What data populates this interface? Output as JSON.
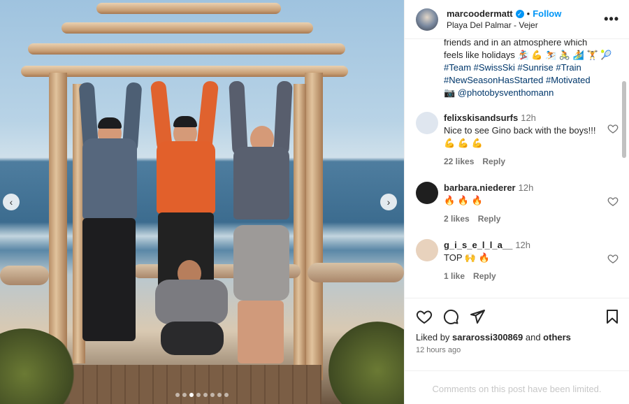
{
  "post": {
    "username": "marcoodermatt",
    "verified_mark": "✓",
    "separator": "•",
    "follow_label": "Follow",
    "location": "Playa Del Palmar - Vejer",
    "more_label": "•••"
  },
  "caption": {
    "line1": "friends and in an atmosphere which",
    "line2": "feels like holidays 🏂 💪 ⛷️ 🚴 🏄 🏋️ 🎾",
    "tags1": "#Team #SwissSki #Sunrise #Train",
    "tags2": "#NewSeasonHasStarted #Motivated",
    "credit": "📷 @photobysventhomann"
  },
  "comments": [
    {
      "user": "felixskisandsurfs",
      "time": "12h",
      "text": "Nice to see Gino back with the boys!!! 💪 💪 💪",
      "likes": "22 likes",
      "reply": "Reply",
      "avatar_color": "#dfe6ef"
    },
    {
      "user": "barbara.niederer",
      "time": "12h",
      "text": "🔥 🔥 🔥",
      "likes": "2 likes",
      "reply": "Reply",
      "avatar_color": "#1f1f1f"
    },
    {
      "user": "g_i_s_e_l_l_a__",
      "time": "12h",
      "text": "TOP 🙌 🔥",
      "likes": "1 like",
      "reply": "Reply",
      "avatar_color": "#e8d2bd"
    }
  ],
  "actions": {
    "liked_by_prefix": "Liked by ",
    "liked_by_user": "sararossi300869",
    "liked_by_and": " and ",
    "liked_by_others": "others",
    "time_ago": "12 hours ago",
    "comments_limited": "Comments on this post have been limited."
  },
  "carousel": {
    "prev_label": "‹",
    "next_label": "›",
    "slide_count": 8,
    "active_slide": 3
  },
  "colors": {
    "accent": "#0095f6",
    "link": "#00376b",
    "muted": "#737373"
  }
}
